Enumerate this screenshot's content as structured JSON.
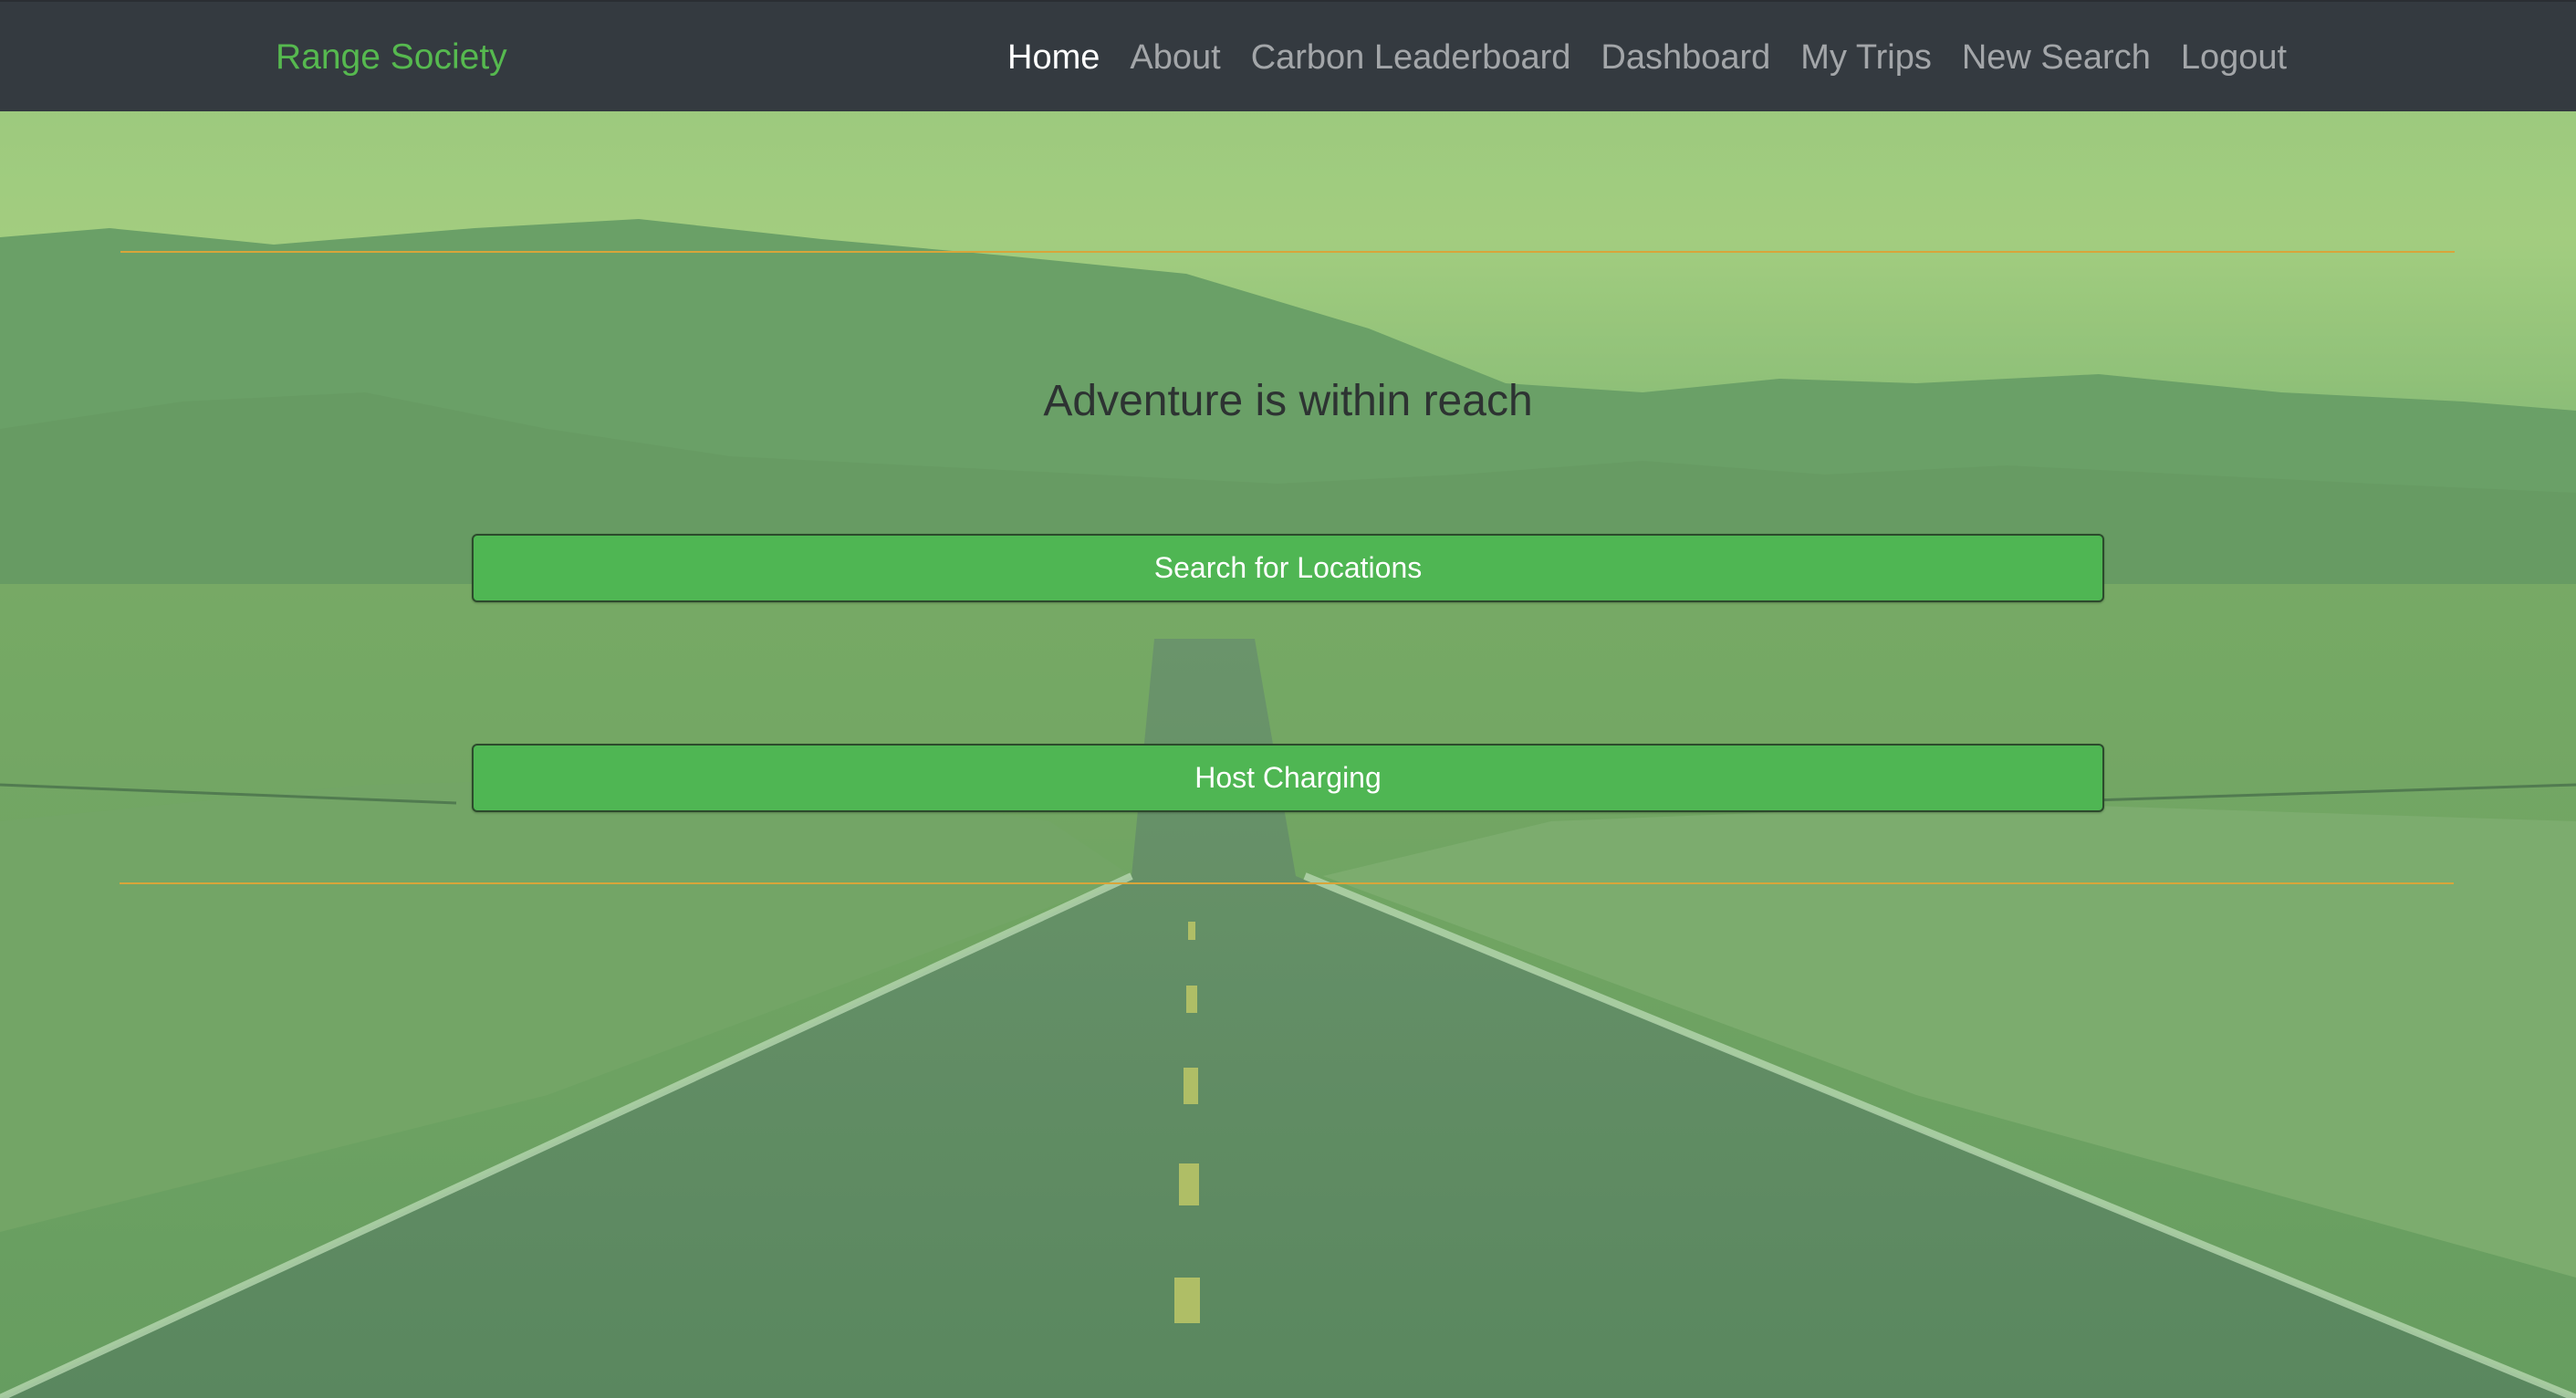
{
  "navbar": {
    "brand": "Range Society",
    "links": [
      {
        "label": "Home",
        "active": true
      },
      {
        "label": "About",
        "active": false
      },
      {
        "label": "Carbon Leaderboard",
        "active": false
      },
      {
        "label": "Dashboard",
        "active": false
      },
      {
        "label": "My Trips",
        "active": false
      },
      {
        "label": "New Search",
        "active": false
      },
      {
        "label": "Logout",
        "active": false
      }
    ]
  },
  "hero": {
    "headline": "Adventure is within reach",
    "search_button": "Search for Locations",
    "host_button": "Host Charging"
  },
  "colors": {
    "navbar_bg": "#343a40",
    "brand": "#56b94f",
    "button_bg": "#4fb653",
    "divider": "#d8a53a",
    "headline": "#2d3332"
  }
}
